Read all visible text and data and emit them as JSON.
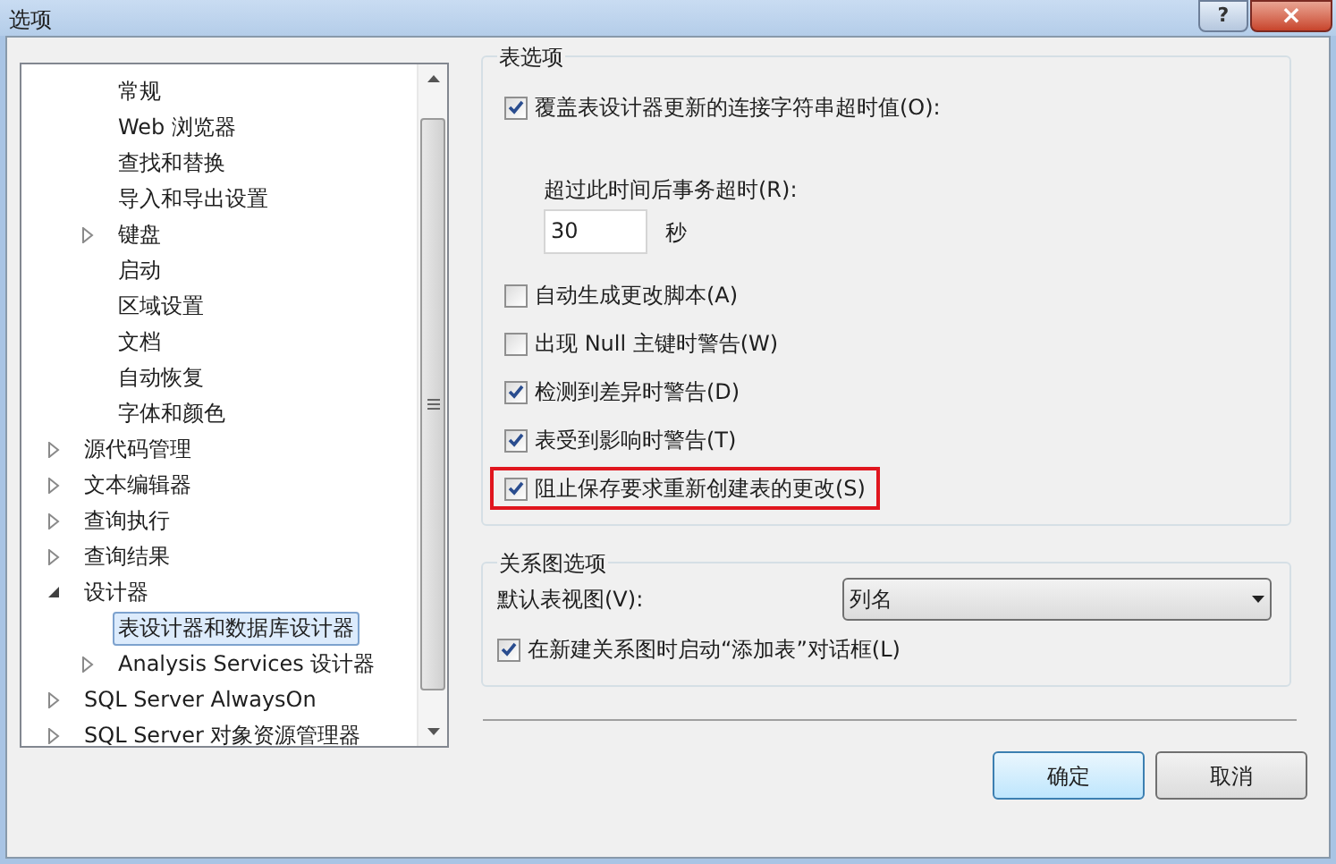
{
  "window": {
    "title": "选项",
    "help_button": "?",
    "close_button": "×"
  },
  "tree": {
    "continued_children": [
      {
        "label": "常规",
        "kind": "leaf",
        "selected": false
      },
      {
        "label": "Web 浏览器",
        "kind": "leaf",
        "selected": false
      },
      {
        "label": "查找和替换",
        "kind": "leaf",
        "selected": false
      },
      {
        "label": "导入和导出设置",
        "kind": "leaf",
        "selected": false
      },
      {
        "label": "键盘",
        "kind": "folder",
        "expanded": false,
        "selected": false
      },
      {
        "label": "启动",
        "kind": "leaf",
        "selected": false
      },
      {
        "label": "区域设置",
        "kind": "leaf",
        "selected": false
      },
      {
        "label": "文档",
        "kind": "leaf",
        "selected": false
      },
      {
        "label": "自动恢复",
        "kind": "leaf",
        "selected": false
      },
      {
        "label": "字体和颜色",
        "kind": "leaf",
        "selected": false
      }
    ],
    "items": [
      {
        "label": "源代码管理",
        "kind": "folder",
        "expanded": false,
        "selected": false
      },
      {
        "label": "文本编辑器",
        "kind": "folder",
        "expanded": false,
        "selected": false
      },
      {
        "label": "查询执行",
        "kind": "folder",
        "expanded": false,
        "selected": false
      },
      {
        "label": "查询结果",
        "kind": "folder",
        "expanded": false,
        "selected": false
      },
      {
        "label": "设计器",
        "kind": "folder",
        "expanded": true,
        "selected": false,
        "children": [
          {
            "label": "表设计器和数据库设计器",
            "kind": "leaf",
            "selected": true
          },
          {
            "label": "Analysis Services 设计器",
            "kind": "folder",
            "expanded": false,
            "selected": false
          }
        ]
      },
      {
        "label": "SQL Server AlwaysOn",
        "kind": "folder",
        "expanded": false,
        "selected": false
      },
      {
        "label": "SQL Server 对象资源管理器",
        "kind": "folder",
        "expanded": false,
        "selected": false
      }
    ]
  },
  "table_options": {
    "title": "表选项",
    "items": [
      {
        "kind": "checkbox",
        "label": "覆盖表设计器更新的连接字符串超时值(O):",
        "checked": true,
        "highlighted": false
      },
      {
        "kind": "number_field",
        "label": "超过此时间后事务超时(R):",
        "value": "30",
        "unit": "秒"
      },
      {
        "kind": "checkbox",
        "label": "自动生成更改脚本(A)",
        "checked": false,
        "highlighted": false
      },
      {
        "kind": "checkbox",
        "label": "出现 Null 主键时警告(W)",
        "checked": false,
        "highlighted": false
      },
      {
        "kind": "checkbox",
        "label": "检测到差异时警告(D)",
        "checked": true,
        "highlighted": false
      },
      {
        "kind": "checkbox",
        "label": "表受到影响时警告(T)",
        "checked": true,
        "highlighted": false
      },
      {
        "kind": "checkbox",
        "label": "阻止保存要求重新创建表的更改(S)",
        "checked": true,
        "highlighted": true
      }
    ]
  },
  "diagram_options": {
    "title": "关系图选项",
    "default_view_label": "默认表视图(V):",
    "default_view_value": "列名",
    "items": [
      {
        "kind": "checkbox",
        "label": "在新建关系图时启动“添加表”对话框(L)",
        "checked": true,
        "highlighted": false
      }
    ]
  },
  "buttons": [
    {
      "label": "确定",
      "default": true
    },
    {
      "label": "取消",
      "default": false
    }
  ]
}
